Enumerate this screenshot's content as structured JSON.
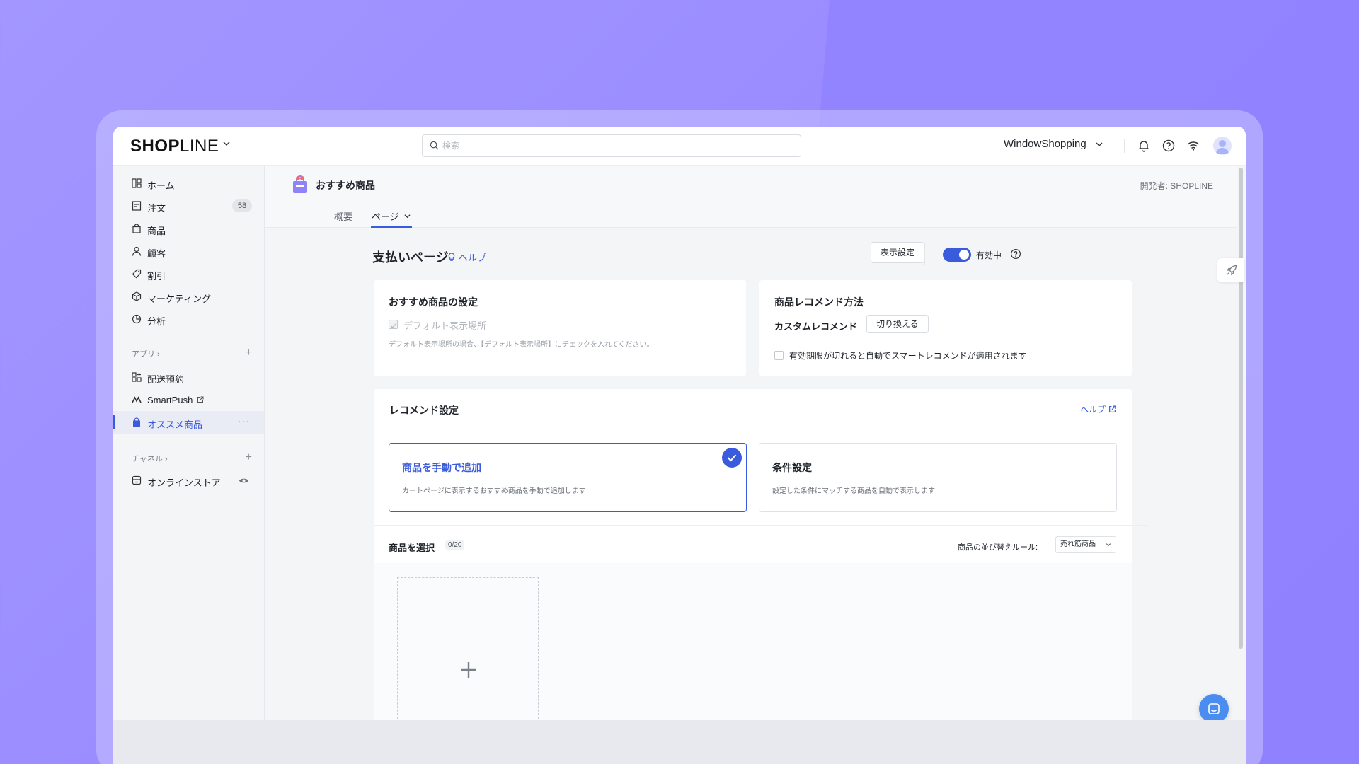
{
  "brand": {
    "logo_bold": "SHOP",
    "logo_light": "LINE"
  },
  "search": {
    "placeholder": "検索"
  },
  "header": {
    "store_name": "WindowShopping"
  },
  "sidebar": {
    "items": [
      {
        "label": "ホーム"
      },
      {
        "label": "注文",
        "badge": "58"
      },
      {
        "label": "商品"
      },
      {
        "label": "顧客"
      },
      {
        "label": "割引"
      },
      {
        "label": "マーケティング"
      },
      {
        "label": "分析"
      }
    ],
    "apps_section": "アプリ ›",
    "apps": [
      {
        "label": "配送預約"
      },
      {
        "label": "SmartPush"
      },
      {
        "label": "オススメ商品"
      }
    ],
    "channels_section": "チャネル ›",
    "channels": [
      {
        "label": "オンラインストア"
      }
    ]
  },
  "app": {
    "title": "おすすめ商品",
    "developer": "開発者: SHOPLINE",
    "tabs": [
      {
        "label": "概要"
      },
      {
        "label": "ページ"
      }
    ]
  },
  "page": {
    "title": "支払いページ",
    "help": "ヘルプ",
    "display_settings_button": "表示設定",
    "status_label": "有効中",
    "status_enabled": true
  },
  "recommend_settings_card": {
    "title": "おすすめ商品の設定",
    "checkbox_label": "デフォルト表示場所",
    "hint": "デフォルト表示場所の場合、【デフォルト表示場所】にチェックを入れてください。"
  },
  "recommend_method_card": {
    "title": "商品レコメンド方法",
    "method": "カスタムレコメンド",
    "switch_button": "切り換える",
    "auto_checkbox_label": "有効期限が切れると自動でスマートレコメンドが適用されます"
  },
  "recommend_config": {
    "title": "レコメンド設定",
    "help": "ヘルプ",
    "options": [
      {
        "title": "商品を手動で追加",
        "desc": "カートページに表示するおすすめ商品を手動で追加します",
        "selected": true
      },
      {
        "title": "条件設定",
        "desc": "設定した条件にマッチする商品を自動で表示します",
        "selected": false
      }
    ],
    "select_products_label": "商品を選択",
    "count": "0/20",
    "sort_label": "商品の並び替えルール:",
    "sort_value": "売れ筋商品"
  },
  "colors": {
    "accent": "#3a5bdc",
    "background": "#9a8cff"
  }
}
